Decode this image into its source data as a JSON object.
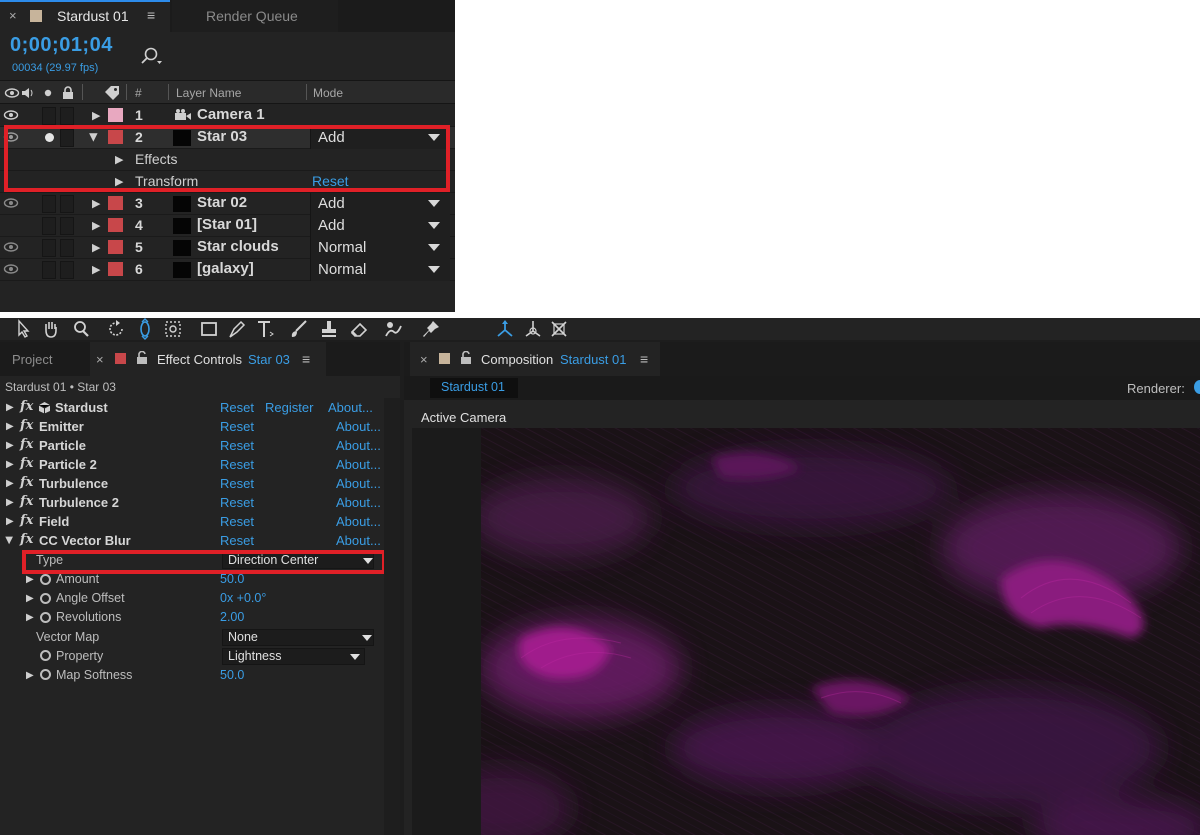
{
  "timeline": {
    "tab_close": "×",
    "tab_title": "Stardust 01",
    "tab_menu": "≡",
    "tab2_title": "Render Queue",
    "timecode": "0;00;01;04",
    "frames": "00034 (29.97 fps)",
    "header": {
      "number": "#",
      "layer_name": "Layer Name",
      "mode": "Mode"
    },
    "layers": [
      {
        "num": "1",
        "name": "Camera 1",
        "mode": ""
      },
      {
        "num": "2",
        "name": "Star 03",
        "mode": "Add"
      },
      {
        "num": "3",
        "name": "Star 02",
        "mode": "Add"
      },
      {
        "num": "4",
        "name": "[Star 01]",
        "mode": "Add"
      },
      {
        "num": "5",
        "name": "Star clouds",
        "mode": "Normal"
      },
      {
        "num": "6",
        "name": "[galaxy]",
        "mode": "Normal"
      }
    ],
    "sub_rows": {
      "effects": "Effects",
      "transform": "Transform",
      "reset": "Reset"
    }
  },
  "effect_controls": {
    "tab_project": "Project",
    "tab_close": "×",
    "tab_label": "Effect Controls",
    "tab_layer": "Star 03",
    "tab_menu": "≡",
    "path": "Stardust 01 • Star 03",
    "fx_badge": "fx",
    "reset": "Reset",
    "register": "Register",
    "about": "About...",
    "effects": [
      "Stardust",
      "Emitter",
      "Particle",
      "Particle 2",
      "Turbulence",
      "Turbulence 2",
      "Field",
      "CC Vector Blur"
    ],
    "props": {
      "type_label": "Type",
      "type_value": "Direction Center",
      "amount_label": "Amount",
      "amount_value": "50.0",
      "angle_label": "Angle Offset",
      "angle_value": "0x +0.0°",
      "revolutions_label": "Revolutions",
      "revolutions_value": "2.00",
      "vector_map_label": "Vector Map",
      "vector_map_value": "None",
      "property_label": "Property",
      "property_value": "Lightness",
      "map_softness_label": "Map Softness",
      "map_softness_value": "50.0"
    }
  },
  "composition": {
    "tab_close": "×",
    "tab_label": "Composition",
    "tab_comp": "Stardust 01",
    "tab_menu": "≡",
    "flow_tab": "Stardust 01",
    "renderer_label": "Renderer:",
    "active_camera": "Active Camera"
  },
  "colors": {
    "accent_blue": "#3a9de4",
    "highlight_red": "#e02027",
    "label_pink": "#e8a8c0",
    "label_red": "#c8474a",
    "nebula": "#a01e8c"
  }
}
